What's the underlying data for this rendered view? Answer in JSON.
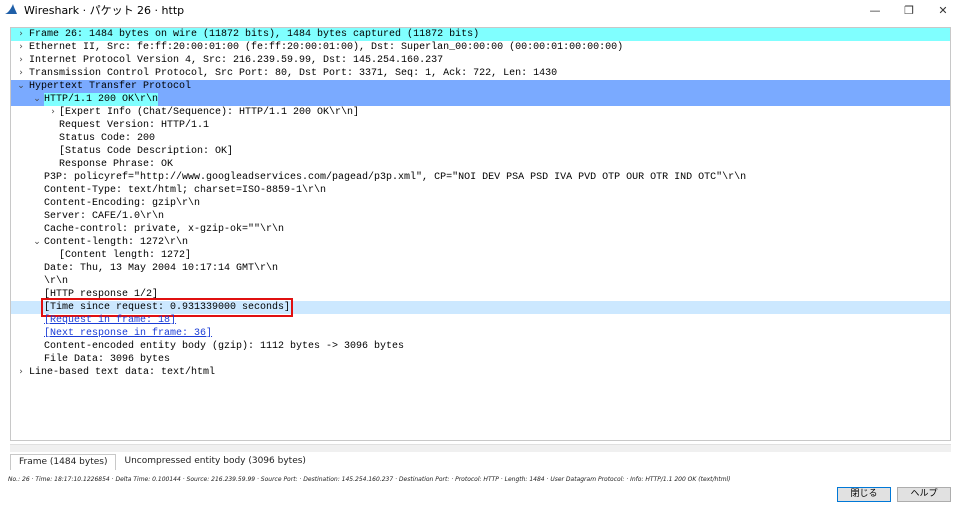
{
  "window": {
    "title": "Wireshark · パケット 26 · http",
    "minimize": "—",
    "maximize": "❐",
    "close": "✕"
  },
  "tree": [
    {
      "text": "Frame 26: 1484 bytes on wire (11872 bits), 1484 bytes captured (11872 bits)",
      "arrow": "›",
      "level": 0,
      "style": "frame-row"
    },
    {
      "text": "Ethernet II, Src: fe:ff:20:00:01:00 (fe:ff:20:00:01:00), Dst: Superlan_00:00:00 (00:00:01:00:00:00)",
      "arrow": "›",
      "level": 0
    },
    {
      "text": "Internet Protocol Version 4, Src: 216.239.59.99, Dst: 145.254.160.237",
      "arrow": "›",
      "level": 0
    },
    {
      "text": "Transmission Control Protocol, Src Port: 80, Dst Port: 3371, Seq: 1, Ack: 722, Len: 1430",
      "arrow": "›",
      "level": 0
    },
    {
      "text": "Hypertext Transfer Protocol",
      "arrow": "⌄",
      "level": 0,
      "style": "proto-sel"
    },
    {
      "text": "HTTP/1.1 200 OK\\r\\n",
      "arrow": "⌄",
      "level": 1,
      "style": "proto-sel",
      "hilite": true
    },
    {
      "text": "[Expert Info (Chat/Sequence): HTTP/1.1 200 OK\\r\\n]",
      "arrow": "›",
      "level": 2
    },
    {
      "text": "Request Version: HTTP/1.1",
      "level": 2
    },
    {
      "text": "Status Code: 200",
      "level": 2
    },
    {
      "text": "[Status Code Description: OK]",
      "level": 2
    },
    {
      "text": "Response Phrase: OK",
      "level": 2
    },
    {
      "text": "P3P: policyref=\"http://www.googleadservices.com/pagead/p3p.xml\", CP=\"NOI DEV PSA PSD IVA PVD OTP OUR OTR IND OTC\"\\r\\n",
      "level": 1
    },
    {
      "text": "Content-Type: text/html; charset=ISO-8859-1\\r\\n",
      "level": 1
    },
    {
      "text": "Content-Encoding: gzip\\r\\n",
      "level": 1
    },
    {
      "text": "Server: CAFE/1.0\\r\\n",
      "level": 1
    },
    {
      "text": "Cache-control: private, x-gzip-ok=\"\"\\r\\n",
      "level": 1
    },
    {
      "text": "Content-length: 1272\\r\\n",
      "arrow": "⌄",
      "level": 1
    },
    {
      "text": "[Content length: 1272]",
      "level": 2
    },
    {
      "text": "Date: Thu, 13 May 2004 10:17:14 GMT\\r\\n",
      "level": 1
    },
    {
      "text": "\\r\\n",
      "level": 1
    },
    {
      "text": "[HTTP response 1/2]",
      "level": 1
    },
    {
      "text": "[Time since request: 0.931339000 seconds]",
      "level": 1,
      "style": "hover-sel",
      "boxed": true
    },
    {
      "text": "[Request in frame: 18]",
      "level": 1,
      "link": true
    },
    {
      "text": "[Next response in frame: 36]",
      "level": 1,
      "link": true
    },
    {
      "text": "Content-encoded entity body (gzip): 1112 bytes -> 3096 bytes",
      "level": 1
    },
    {
      "text": "File Data: 3096 bytes",
      "level": 1
    },
    {
      "text": "Line-based text data: text/html",
      "arrow": "›",
      "level": 0
    }
  ],
  "tabs": {
    "frame": "Frame (1484 bytes)",
    "uncompressed": "Uncompressed entity body (3096 bytes)"
  },
  "status": "No.: 26 · Time: 18:17:10.1226854 · Delta Time: 0.100144 · Source: 216.239.59.99 · Source Port: · Destination: 145.254.160.237 · Destination Port: · Protocol: HTTP · Length: 1484 · User Datagram Protocol: · Info: HTTP/1.1 200 OK (text/html)",
  "buttons": {
    "close": "閉じる",
    "help": "ヘルプ"
  },
  "colors": {
    "frame_highlight": "#80ffff",
    "protocol_selected": "#7aaaff",
    "row_selected": "#cce8ff",
    "annotation_box": "#e01010",
    "link": "#1a3cd6"
  }
}
